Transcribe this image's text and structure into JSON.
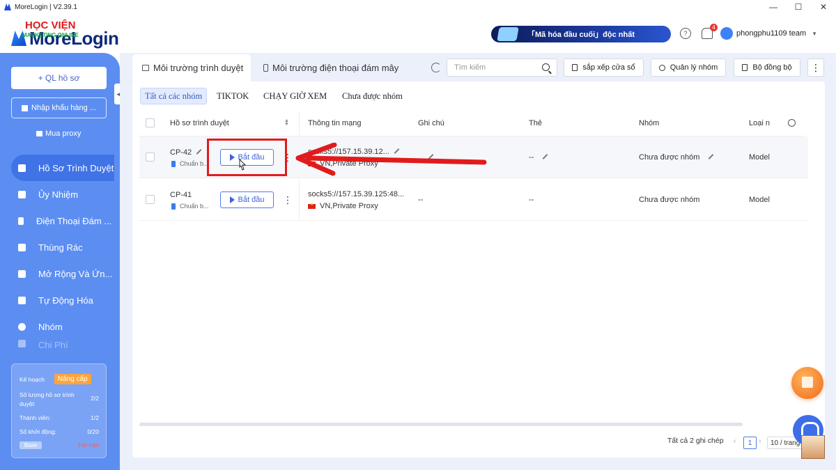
{
  "window": {
    "title": "MoreLogin | V2.39.1",
    "controls": [
      "—",
      "☐",
      "✕"
    ]
  },
  "header": {
    "logo_text": "MoreLogin",
    "watermark": "HỌC VIỆN",
    "watermark_sub": "MARKETING ONLINE",
    "promo_text": "「Mã hóa đầu cuối」độc nhất",
    "notification_count": "4",
    "user_name": "phongphu1109 team"
  },
  "sidebar": {
    "new_profile_label": "+ QL hồ sơ",
    "import_label": "Nhập khẩu hàng ...",
    "buy_proxy_label": "Mua proxy",
    "nav": [
      {
        "label": "Hồ Sơ Trình Duyệt",
        "icon": "browser-icon",
        "active": true
      },
      {
        "label": "Ủy Nhiệm",
        "icon": "proxy-icon"
      },
      {
        "label": "Điện Thoại Đám ...",
        "icon": "phone-icon"
      },
      {
        "label": "Thùng Rác",
        "icon": "trash-icon"
      },
      {
        "label": "Mở Rộng Và Ứn...",
        "icon": "extension-icon"
      },
      {
        "label": "Tự Động Hóa",
        "icon": "automation-icon"
      },
      {
        "label": "Nhóm",
        "icon": "group-icon"
      },
      {
        "label": "Chi Phí",
        "icon": "cost-icon"
      }
    ],
    "plan": {
      "plan_label": "Kế hoạch",
      "upgrade_label": "Nâng cấp",
      "profiles_label": "Số lượng hồ sơ trình duyệt:",
      "profiles_value": "2/2",
      "members_label": "Thành viên:",
      "members_value": "1/2",
      "launches_label": "Số khởi động:",
      "launches_value": "0/20",
      "tier": "Base",
      "status": "Hết hạn"
    }
  },
  "tabs": [
    {
      "label": "Môi trường trình duyệt",
      "active": true
    },
    {
      "label": "Môi trường điện thoại đám mây",
      "active": false
    }
  ],
  "toolbar": {
    "search_placeholder": "Tìm kiếm",
    "arrange_label": "sắp xếp cửa sổ",
    "group_manage_label": "Quản lý nhóm",
    "sync_label": "Bộ đồng bộ",
    "more_label": "⋮"
  },
  "filters": [
    "Tất cả các nhóm",
    "TIKTOK",
    "CHẠY GIỜ XEM",
    "Chưa được nhóm"
  ],
  "table": {
    "columns": [
      "Hồ sơ trình duyệt",
      "Thông tin mạng",
      "Ghi chú",
      "Thẻ",
      "Nhóm",
      "Loại n"
    ],
    "rows": [
      {
        "name": "CP-42",
        "status": "Chuẩn b...",
        "start_label": "Bắt đầu",
        "network": "socks5://157.15.39.12...",
        "proxy_label": "VN,Private Proxy",
        "note": "--",
        "tag": "--",
        "group": "Chưa được nhóm",
        "type": "Model"
      },
      {
        "name": "CP-41",
        "status": "Chuẩn b...",
        "start_label": "Bắt đầu",
        "network": "socks5://157.15.39.125:48...",
        "proxy_label": "VN,Private Proxy",
        "note": "--",
        "tag": "--",
        "group": "Chưa được nhóm",
        "type": "Model"
      }
    ]
  },
  "pagination": {
    "total_label": "Tất cả 2 ghi chép",
    "current_page": "1",
    "page_size": "10 / trang"
  }
}
